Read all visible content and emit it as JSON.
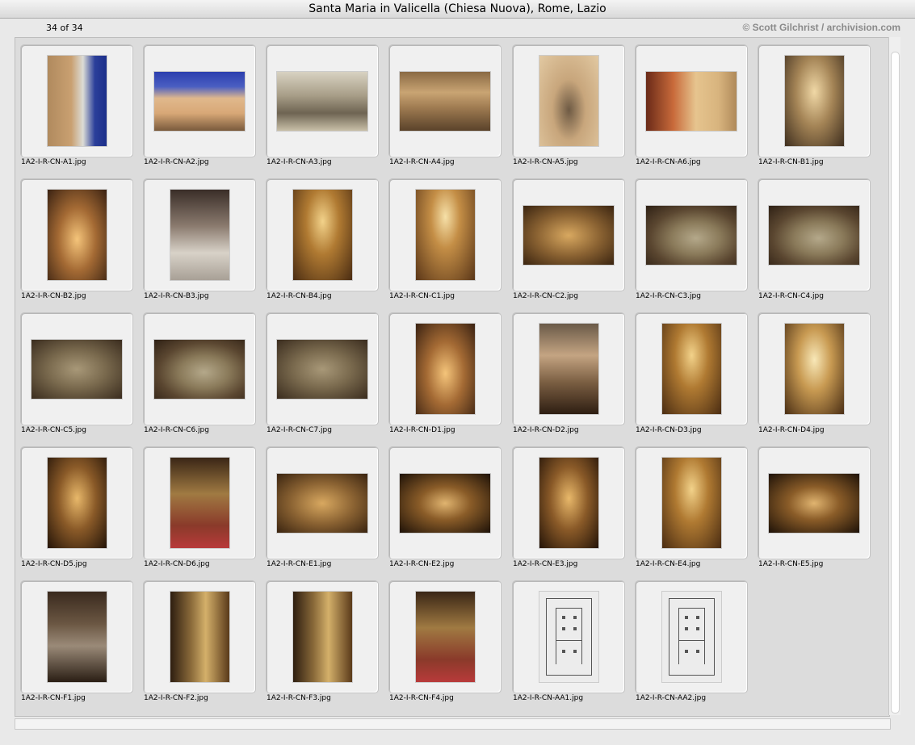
{
  "window": {
    "title": "Santa Maria in Valicella (Chiesa Nuova), Rome, Lazio"
  },
  "header": {
    "counter": "34 of 34",
    "credit": "© Scott Gilchrist / archivision.com"
  },
  "colors": {
    "panel": "#dcdcdc",
    "tile": "#f0f0f0",
    "credit": "#8a8a8a"
  },
  "items": [
    {
      "file": "1A2-I-R-CN-A1.jpg",
      "orient": "portrait",
      "tone": "exterior-sky"
    },
    {
      "file": "1A2-I-R-CN-A2.jpg",
      "orient": "landscape",
      "tone": "facade-sky"
    },
    {
      "file": "1A2-I-R-CN-A3.jpg",
      "orient": "landscape",
      "tone": "stone-relief"
    },
    {
      "file": "1A2-I-R-CN-A4.jpg",
      "orient": "landscape",
      "tone": "stone-warm"
    },
    {
      "file": "1A2-I-R-CN-A5.jpg",
      "orient": "portrait",
      "tone": "stone-niche"
    },
    {
      "file": "1A2-I-R-CN-A6.jpg",
      "orient": "landscape",
      "tone": "stone-volute"
    },
    {
      "file": "1A2-I-R-CN-B1.jpg",
      "orient": "portrait",
      "tone": "nave-light"
    },
    {
      "file": "1A2-I-R-CN-B2.jpg",
      "orient": "portrait",
      "tone": "interior-warm"
    },
    {
      "file": "1A2-I-R-CN-B3.jpg",
      "orient": "portrait",
      "tone": "marble-chapel"
    },
    {
      "file": "1A2-I-R-CN-B4.jpg",
      "orient": "portrait",
      "tone": "gold-dome"
    },
    {
      "file": "1A2-I-R-CN-C1.jpg",
      "orient": "portrait",
      "tone": "gold-nave"
    },
    {
      "file": "1A2-I-R-CN-C2.jpg",
      "orient": "landscape",
      "tone": "ceiling"
    },
    {
      "file": "1A2-I-R-CN-C3.jpg",
      "orient": "landscape",
      "tone": "ceiling-oval"
    },
    {
      "file": "1A2-I-R-CN-C4.jpg",
      "orient": "landscape",
      "tone": "ceiling-oval"
    },
    {
      "file": "1A2-I-R-CN-C5.jpg",
      "orient": "landscape",
      "tone": "ceiling-figure"
    },
    {
      "file": "1A2-I-R-CN-C6.jpg",
      "orient": "landscape",
      "tone": "ceiling-oval"
    },
    {
      "file": "1A2-I-R-CN-C7.jpg",
      "orient": "landscape",
      "tone": "ceiling-figure"
    },
    {
      "file": "1A2-I-R-CN-D1.jpg",
      "orient": "portrait",
      "tone": "interior-warm"
    },
    {
      "file": "1A2-I-R-CN-D2.jpg",
      "orient": "portrait",
      "tone": "interior-pews"
    },
    {
      "file": "1A2-I-R-CN-D3.jpg",
      "orient": "portrait",
      "tone": "gold-dome"
    },
    {
      "file": "1A2-I-R-CN-D4.jpg",
      "orient": "portrait",
      "tone": "arcade"
    },
    {
      "file": "1A2-I-R-CN-D5.jpg",
      "orient": "portrait",
      "tone": "gold-dark"
    },
    {
      "file": "1A2-I-R-CN-D6.jpg",
      "orient": "portrait",
      "tone": "altar-red"
    },
    {
      "file": "1A2-I-R-CN-E1.jpg",
      "orient": "landscape",
      "tone": "ceiling"
    },
    {
      "file": "1A2-I-R-CN-E2.jpg",
      "orient": "landscape",
      "tone": "ceiling-dark"
    },
    {
      "file": "1A2-I-R-CN-E3.jpg",
      "orient": "portrait",
      "tone": "gold-dark"
    },
    {
      "file": "1A2-I-R-CN-E4.jpg",
      "orient": "portrait",
      "tone": "gold-dome"
    },
    {
      "file": "1A2-I-R-CN-E5.jpg",
      "orient": "landscape",
      "tone": "ceiling-dark"
    },
    {
      "file": "1A2-I-R-CN-F1.jpg",
      "orient": "portrait",
      "tone": "tomb-dark"
    },
    {
      "file": "1A2-I-R-CN-F2.jpg",
      "orient": "portrait",
      "tone": "chapel-dark"
    },
    {
      "file": "1A2-I-R-CN-F3.jpg",
      "orient": "portrait",
      "tone": "chapel-dark"
    },
    {
      "file": "1A2-I-R-CN-F4.jpg",
      "orient": "portrait",
      "tone": "altar-red"
    },
    {
      "file": "1A2-I-R-CN-AA1.jpg",
      "orient": "portrait",
      "tone": "plan"
    },
    {
      "file": "1A2-I-R-CN-AA2.jpg",
      "orient": "portrait",
      "tone": "plan"
    }
  ]
}
